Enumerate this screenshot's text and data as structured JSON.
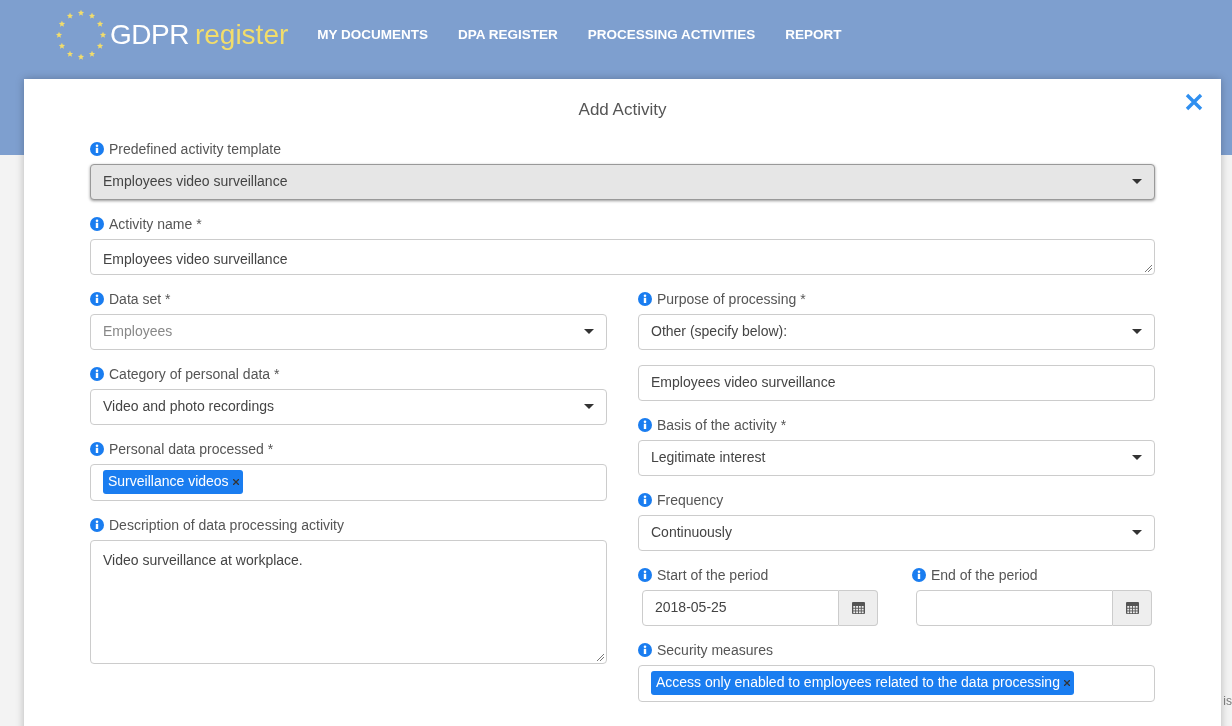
{
  "header": {
    "logo": {
      "first": "GDPR",
      "second": "register"
    },
    "nav": [
      "MY DOCUMENTS",
      "DPA REGISTER",
      "PROCESSING ACTIVITIES",
      "REPORT"
    ]
  },
  "background_fragment": "is",
  "modal": {
    "title": "Add Activity",
    "full_fields": [
      {
        "kind": "select",
        "label": "Predefined activity template",
        "value": "Employees video surveillance",
        "highlighted": true
      },
      {
        "kind": "line_area",
        "label": "Activity name *",
        "value": "Employees video surveillance"
      }
    ],
    "left_fields": [
      {
        "kind": "select",
        "label": "Data set *",
        "placeholder": "Employees"
      },
      {
        "kind": "select",
        "label": "Category of personal data *",
        "value": "Video and photo recordings"
      },
      {
        "kind": "tags",
        "label": "Personal data processed *",
        "tags": [
          "Surveillance videos"
        ]
      },
      {
        "kind": "textarea",
        "label": "Description of data processing activity",
        "value": "Video surveillance at workplace."
      }
    ],
    "right_fields": [
      {
        "kind": "select",
        "label": "Purpose of processing *",
        "value": "Other (specify below):"
      },
      {
        "kind": "input",
        "value": "Employees video surveillance"
      },
      {
        "kind": "select",
        "label": "Basis of the activity *",
        "value": "Legitimate interest"
      },
      {
        "kind": "select",
        "label": "Frequency",
        "value": "Continuously"
      },
      {
        "kind": "dates",
        "dates": [
          {
            "label": "Start of the period",
            "value": "2018-05-25"
          },
          {
            "label": "End of the period"
          }
        ]
      },
      {
        "kind": "tags",
        "label": "Security measures",
        "tags": [
          "Access only enabled to employees related to the data processing"
        ]
      }
    ]
  }
}
